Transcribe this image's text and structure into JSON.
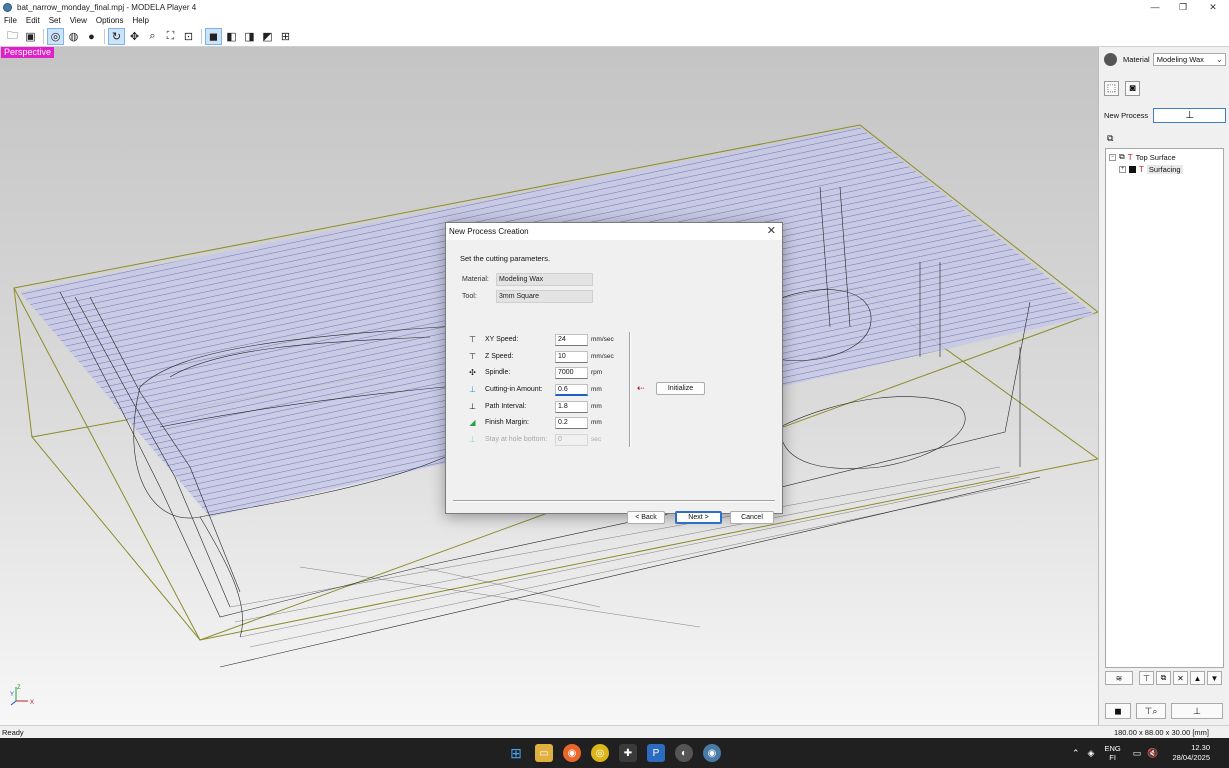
{
  "window": {
    "title": "bat_narrow_monday_final.mpj - MODELA Player 4"
  },
  "menu": [
    "File",
    "Edit",
    "Set",
    "View",
    "Options",
    "Help"
  ],
  "viewport": {
    "view_label": "Perspective",
    "axis_labels": {
      "z": "Z",
      "y": "Y",
      "x": "X"
    }
  },
  "right_panel": {
    "material_label": "Material",
    "material_value": "Modeling Wax",
    "new_process_label": "New Process",
    "tree": [
      {
        "label": "Top Surface"
      },
      {
        "label": "Surfacing"
      }
    ]
  },
  "dialog": {
    "title": "New Process Creation",
    "instruction": "Set the cutting parameters.",
    "material_label": "Material:",
    "material_value": "Modeling Wax",
    "tool_label": "Tool:",
    "tool_value": "3mm Square",
    "params": [
      {
        "label": "XY Speed:",
        "value": "24",
        "unit": "mm/sec"
      },
      {
        "label": "Z Speed:",
        "value": "10",
        "unit": "mm/sec"
      },
      {
        "label": "Spindle:",
        "value": "7000",
        "unit": "rpm"
      },
      {
        "label": "Cutting-in Amount:",
        "value": "0.6",
        "unit": "mm"
      },
      {
        "label": "Path Interval:",
        "value": "1.8",
        "unit": "mm"
      },
      {
        "label": "Finish Margin:",
        "value": "0.2",
        "unit": "mm"
      },
      {
        "label": "Stay at hole bottom:",
        "value": "0",
        "unit": "sec"
      }
    ],
    "initialize_label": "Initialize",
    "back_label": "< Back",
    "next_label": "Next >",
    "cancel_label": "Cancel"
  },
  "status": {
    "ready": "Ready",
    "dimensions": "180.00 x 88.00 x 30.00 [mm]"
  },
  "taskbar": {
    "language": "ENG",
    "region": "FI",
    "time": "12.30",
    "date": "28/04/2025"
  }
}
